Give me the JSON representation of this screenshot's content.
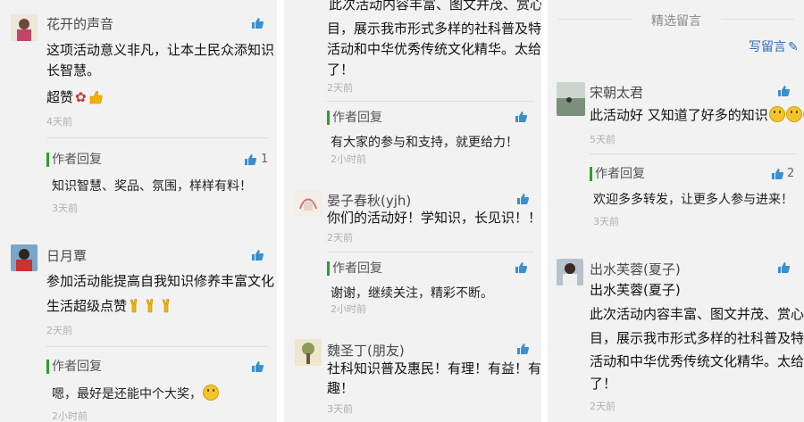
{
  "panel1": {
    "comments": [
      {
        "name": "花开的声音",
        "lines": [
          "这项活动意义非凡，让本土民众添知识",
          "长智慧。",
          "超赞"
        ],
        "time": "4天前",
        "reply": {
          "label": "作者回复",
          "text": "知识智慧、奖品、氛围，样样有料！",
          "time": "3天前",
          "likes": "1"
        }
      },
      {
        "name": "日月覃",
        "lines": [
          "参加活动能提高自我知识修养丰富文化",
          "生活超级点赞"
        ],
        "time": "2天前",
        "reply": {
          "label": "作者回复",
          "text": "嗯，最好是还能中个大奖，",
          "time": "2小时前"
        }
      }
    ]
  },
  "panel2": {
    "top_lines": [
      "此次活动内容丰富、图文并茂、赏心悦",
      "目，展示我市形式多样的社科普及特色",
      "活动和中华优秀传统文化精华。太给力",
      "了！"
    ],
    "top_time": "2天前",
    "top_reply": {
      "label": "作者回复",
      "text": "有大家的参与和支持，就更给力！",
      "time": "2小时前"
    },
    "comments": [
      {
        "name": "晏子春秋(yjh)",
        "lines": [
          "你们的活动好！学知识，长见识！！！"
        ],
        "time": "2天前",
        "reply": {
          "label": "作者回复",
          "text": "谢谢，继续关注，精彩不断。",
          "time": "2小时前"
        }
      },
      {
        "name": "魏圣丁(朋友)",
        "lines": [
          "社科知识普及惠民！有理！有益！有",
          "趣！"
        ],
        "time": "3天前"
      }
    ]
  },
  "panel3": {
    "section_title": "精选留言",
    "write_label": "写留言",
    "comments": [
      {
        "name": "宋朝太君",
        "lines": [
          "此活动好 又知道了好多的知识"
        ],
        "time": "5天前",
        "reply": {
          "label": "作者回复",
          "text": "欢迎多多转发，让更多人参与进来！",
          "time": "3天前",
          "likes": "2"
        }
      },
      {
        "name": "出水芙蓉(夏子)",
        "lines": [
          "出水芙蓉(夏子)",
          " 此次活动内容丰富、图文并茂、赏心悦",
          "目，展示我市形式多样的社科普及特色",
          "活动和中华优秀传统文化精华。太给力",
          "了！"
        ],
        "time": "2天前"
      }
    ]
  }
}
